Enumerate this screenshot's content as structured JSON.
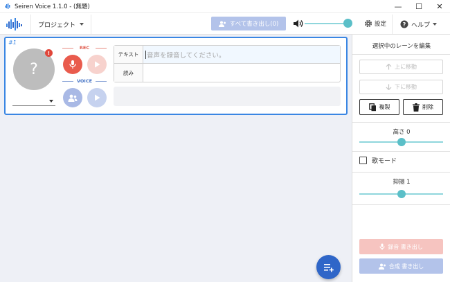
{
  "window": {
    "title": "Seiren Voice 1.1.0 - (無題)",
    "controls": {
      "minimize": "—",
      "maximize": "☐",
      "close": "✕"
    }
  },
  "toolbar": {
    "project_label": "プロジェクト",
    "export_all_label": "すべて書き出し(0)",
    "volume_level_fraction": 0.93,
    "settings_label": "設定",
    "help_label": "ヘルプ"
  },
  "lane": {
    "number": "#1",
    "avatar_glyph": "?",
    "avatar_badge": "!",
    "rec_label": "REC",
    "voice_label": "VOICE",
    "text_label": "テキスト",
    "text_placeholder": "音声を録音してください。",
    "reading_label": "読み",
    "reading_value": ""
  },
  "side": {
    "title": "選択中のレーンを編集",
    "move_up": "上に移動",
    "move_down": "下に移動",
    "duplicate": "複製",
    "delete": "削除",
    "height_label": "高さ 0",
    "height_fraction": 0.5,
    "singing_mode": "歌モード",
    "singing_checked": false,
    "intonation_label": "抑揚 1",
    "intonation_fraction": 0.5,
    "export_recording": "録音 書き出し",
    "export_synth": "合成 書き出し"
  },
  "colors": {
    "accent_blue": "#2f66c8",
    "lane_border": "#3a86e3",
    "rec_red": "#e95b4d",
    "slider_teal": "#5bbfc8",
    "disabled_blue": "#b3c3ea",
    "disabled_red": "#f6c4c0"
  }
}
